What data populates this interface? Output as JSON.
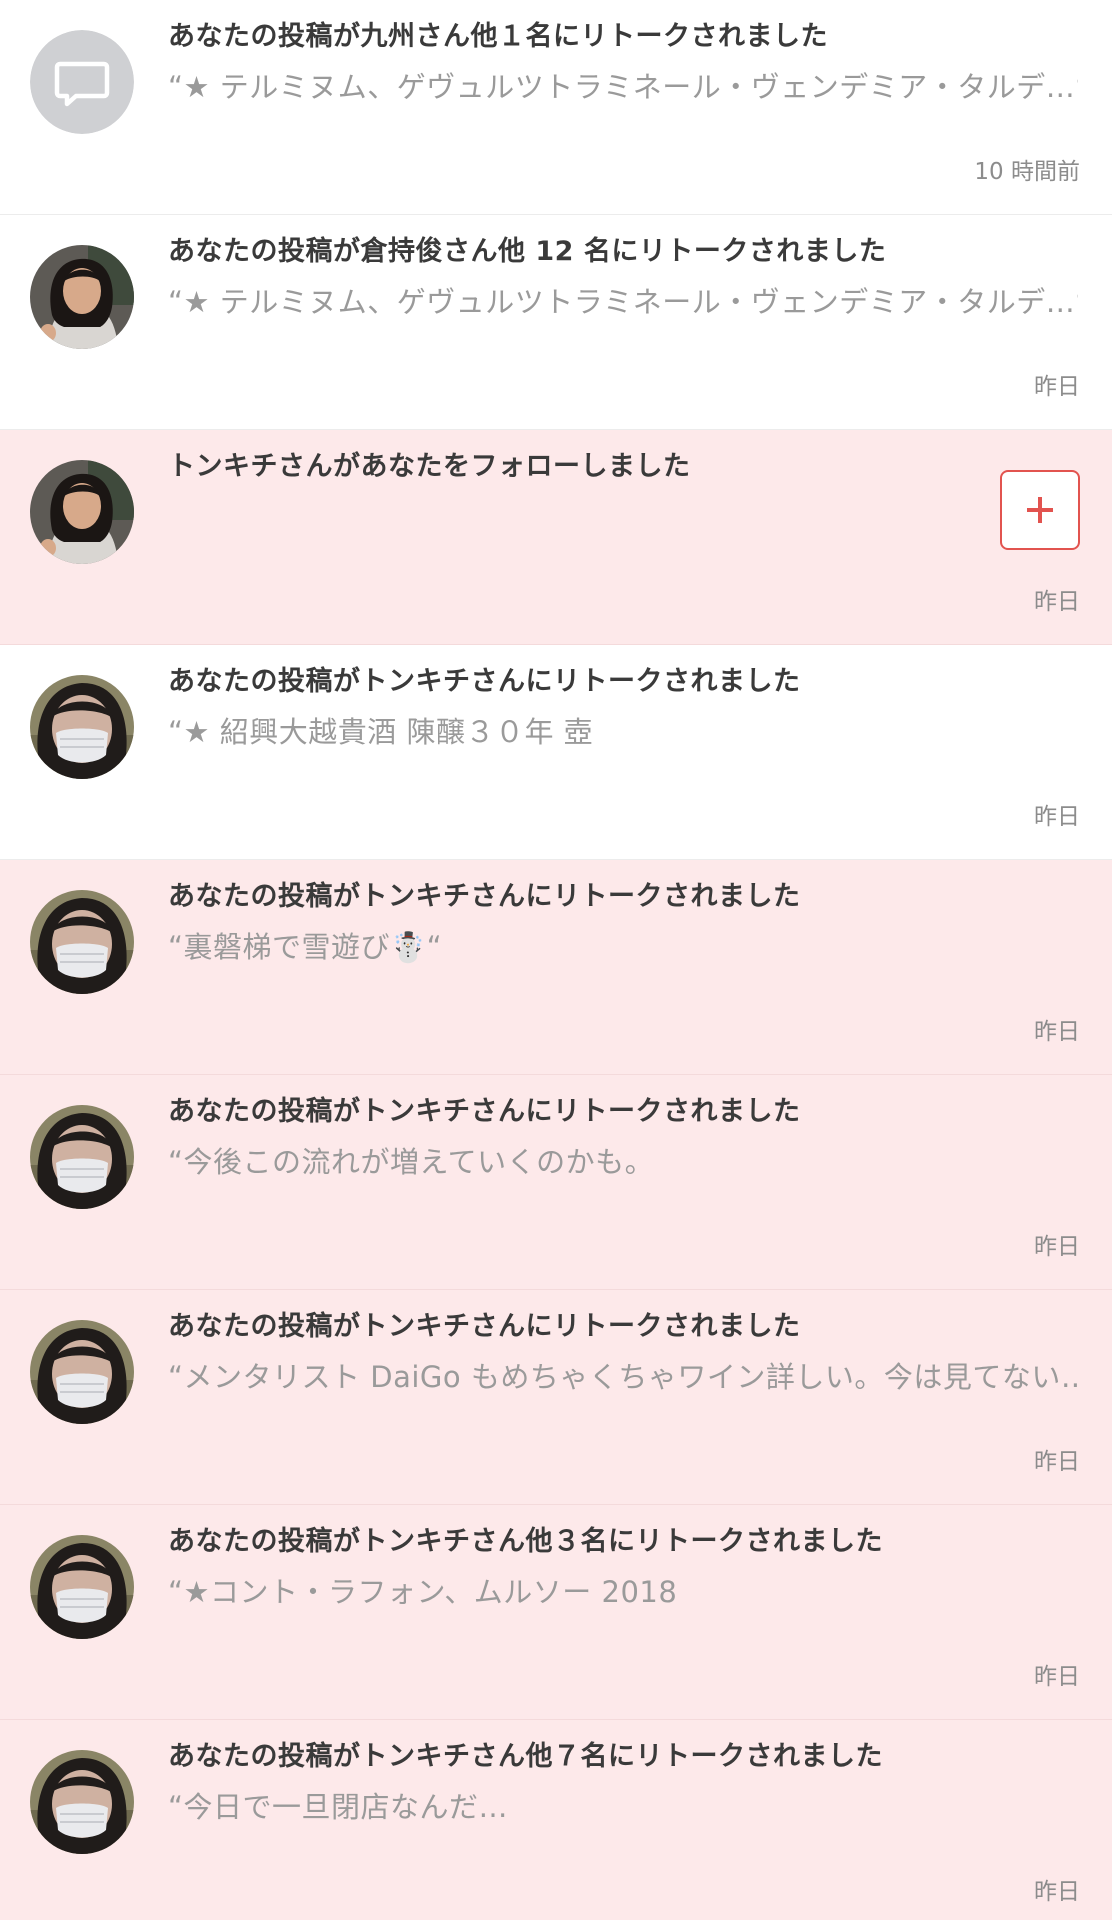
{
  "notifications": [
    {
      "title": "あなたの投稿が九州さん他１名にリトークされました",
      "snippet": "“★ テルミヌム、ゲヴュルツトラミネール・ヴェンデミア・タルデ…“",
      "time": "10 時間前",
      "avatar": "default-chat-icon",
      "unread": false
    },
    {
      "title": "あなたの投稿が倉持俊さん他 12 名にリトークされました",
      "snippet": "“★ テルミヌム、ゲヴュルツトラミネール・ヴェンデミア・タルデ…“",
      "time": "昨日",
      "avatar": "woman-photo",
      "unread": false
    },
    {
      "title": "トンキチさんがあなたをフォローしました",
      "snippet": "",
      "time": "昨日",
      "avatar": "woman-photo",
      "unread": true,
      "follow_button_icon": "plus-icon"
    },
    {
      "title": "あなたの投稿がトンキチさんにリトークされました",
      "snippet": "“★ 紹興大越貴酒 陳醸３０年 壺",
      "time": "昨日",
      "avatar": "masked-person-photo",
      "unread": false
    },
    {
      "title": "あなたの投稿がトンキチさんにリトークされました",
      "snippet": "“裏磐梯で雪遊び☃️“",
      "time": "昨日",
      "avatar": "masked-person-photo",
      "unread": true
    },
    {
      "title": "あなたの投稿がトンキチさんにリトークされました",
      "snippet": "“今後この流れが増えていくのかも。",
      "time": "昨日",
      "avatar": "masked-person-photo",
      "unread": true
    },
    {
      "title": "あなたの投稿がトンキチさんにリトークされました",
      "snippet": "“メンタリスト DaiGo もめちゃくちゃワイン詳しい。今は見てない…“",
      "time": "昨日",
      "avatar": "masked-person-photo",
      "unread": true
    },
    {
      "title": "あなたの投稿がトンキチさん他３名にリトークされました",
      "snippet": "“★コント・ラフォン、ムルソー 2018",
      "time": "昨日",
      "avatar": "masked-person-photo",
      "unread": true
    },
    {
      "title": "あなたの投稿がトンキチさん他７名にリトークされました",
      "snippet": "“今日で一旦閉店なんだ…",
      "time": "昨日",
      "avatar": "masked-person-photo",
      "unread": true
    }
  ],
  "colors": {
    "unread_background": "#fde9ea",
    "read_background": "#ffffff",
    "title_text": "#3a3a3a",
    "snippet_text": "#9a9a9a",
    "time_text": "#8c8c8c",
    "follow_accent": "#e2534f"
  }
}
